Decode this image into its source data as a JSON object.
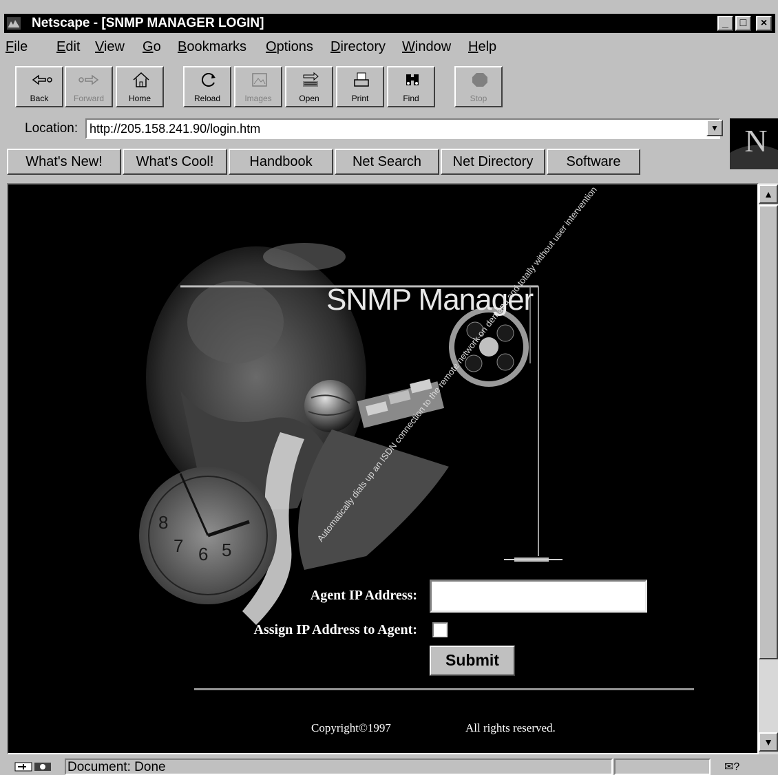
{
  "window": {
    "title": "Netscape - [SNMP MANAGER LOGIN]",
    "controls": [
      "_",
      "□",
      "×"
    ]
  },
  "menu": [
    {
      "label": "File",
      "accel": "F",
      "rest": "ile"
    },
    {
      "label": "Edit",
      "accel": "E",
      "rest": "dit"
    },
    {
      "label": "View",
      "accel": "V",
      "rest": "iew"
    },
    {
      "label": "Go",
      "accel": "G",
      "rest": "o"
    },
    {
      "label": "Bookmarks",
      "accel": "B",
      "rest": "ookmarks"
    },
    {
      "label": "Options",
      "accel": "O",
      "rest": "ptions"
    },
    {
      "label": "Directory",
      "accel": "D",
      "rest": "irectory"
    },
    {
      "label": "Window",
      "accel": "W",
      "rest": "indow"
    },
    {
      "label": "Help",
      "accel": "H",
      "rest": "elp"
    }
  ],
  "toolbar": [
    {
      "label": "Back",
      "icon": "back-arrow-icon",
      "enabled": true
    },
    {
      "label": "Forward",
      "icon": "forward-arrow-icon",
      "enabled": false
    },
    {
      "label": "Home",
      "icon": "home-icon",
      "enabled": true
    },
    {
      "label": "Reload",
      "icon": "reload-icon",
      "enabled": true
    },
    {
      "label": "Images",
      "icon": "images-icon",
      "enabled": false
    },
    {
      "label": "Open",
      "icon": "open-icon",
      "enabled": true
    },
    {
      "label": "Print",
      "icon": "print-icon",
      "enabled": true
    },
    {
      "label": "Find",
      "icon": "find-icon",
      "enabled": true
    },
    {
      "label": "Stop",
      "icon": "stop-icon",
      "enabled": false
    }
  ],
  "location": {
    "label": "Location:",
    "url": "http://205.158.241.90/login.htm"
  },
  "directory_buttons": [
    "What's New!",
    "What's Cool!",
    "Handbook",
    "Net Search",
    "Net Directory",
    "Software"
  ],
  "logo": {
    "letter": "N"
  },
  "page": {
    "banner_title": "SNMP Manager",
    "collage_caption": "Automatically dials up an ISDN connection to the remote network on demand and totally without user intervention",
    "clock_numerals": [
      "8",
      "7",
      "6",
      "5"
    ],
    "form": {
      "agent_ip_label": "Agent IP Address:",
      "agent_ip_value": "",
      "assign_label": "Assign IP Address to Agent:",
      "assign_checked": false,
      "submit_label": "Submit"
    },
    "footer": {
      "copyright": "Copyright©1997",
      "rights": "All rights reserved."
    }
  },
  "status": {
    "text": "Document: Done"
  },
  "colors": {
    "chrome": "#c0c0c0",
    "titlebar": "#000000",
    "page_background": "#000000"
  }
}
